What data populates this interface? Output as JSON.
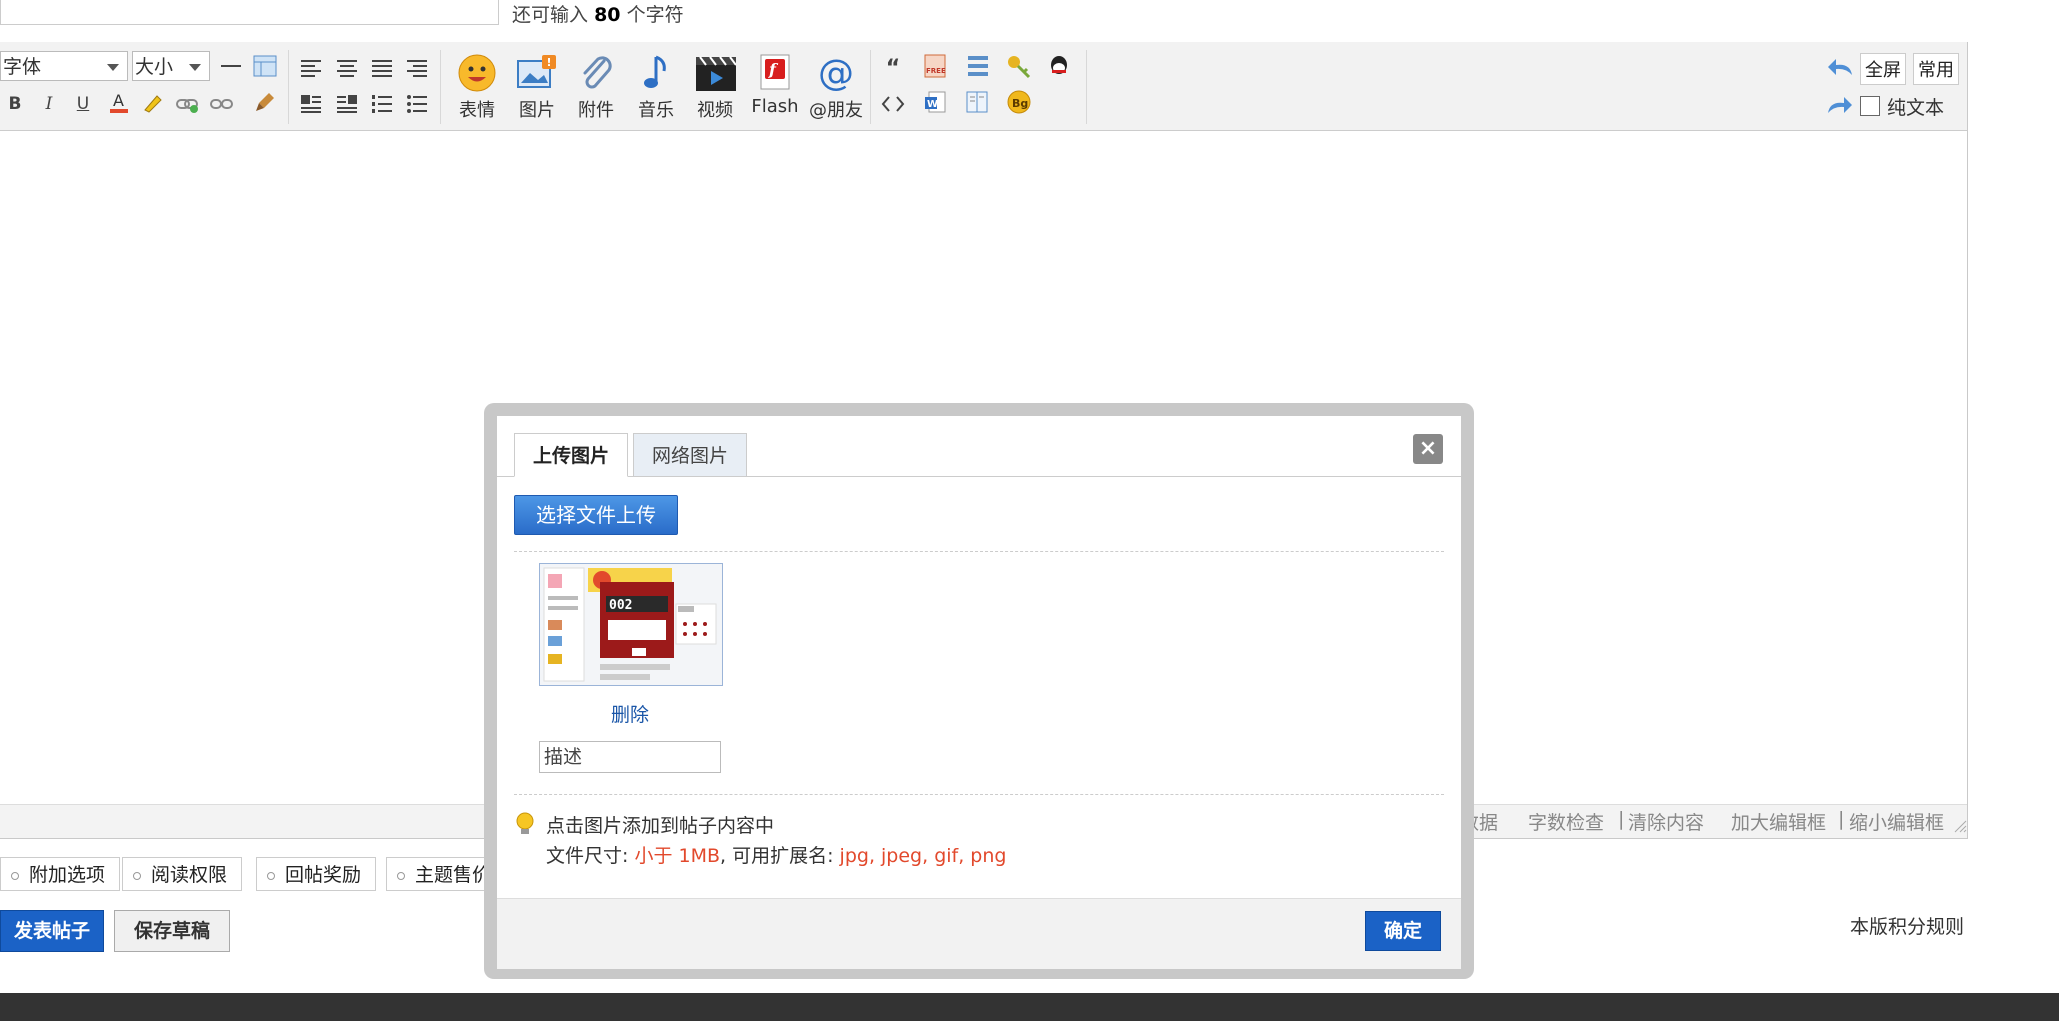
{
  "header": {
    "char_hint_prefix": "还可输入",
    "char_hint_count": "80",
    "char_hint_suffix": "个字符"
  },
  "toolbar": {
    "font_select": "字体",
    "size_select": "大小",
    "big_buttons": [
      {
        "label": "表情",
        "icon": "smiley-icon"
      },
      {
        "label": "图片",
        "icon": "image-icon"
      },
      {
        "label": "附件",
        "icon": "paperclip-icon"
      },
      {
        "label": "音乐",
        "icon": "music-note-icon"
      },
      {
        "label": "视频",
        "icon": "film-icon"
      },
      {
        "label": "Flash",
        "icon": "flash-icon"
      },
      {
        "label": "@朋友",
        "icon": "at-icon"
      }
    ],
    "fullscreen_label": "全屏",
    "common_label": "常用",
    "plaintext_label": "纯文本"
  },
  "status_bar": {
    "data_label": "数据",
    "wordcount_label": "字数检查",
    "clear_label": "清除内容",
    "enlarge_label": "加大编辑框",
    "shrink_label": "缩小编辑框"
  },
  "options": [
    "附加选项",
    "阅读权限",
    "回帖奖励",
    "主题售价"
  ],
  "actions": {
    "publish_label": "发表帖子",
    "draft_label": "保存草稿",
    "rules_link": "本版积分规则"
  },
  "dialog": {
    "tab_upload": "上传图片",
    "tab_web": "网络图片",
    "close_symbol": "×",
    "upload_button": "选择文件上传",
    "delete_link": "删除",
    "desc_value": "描述",
    "tip_line1": "点击图片添加到帖子内容中",
    "size_prefix": "文件尺寸:",
    "size_value": "小于 1MB",
    "ext_prefix": ", 可用扩展名:",
    "ext_value": "jpg, jpeg, gif, png",
    "ok_button": "确定",
    "thumb_counter": "002"
  }
}
